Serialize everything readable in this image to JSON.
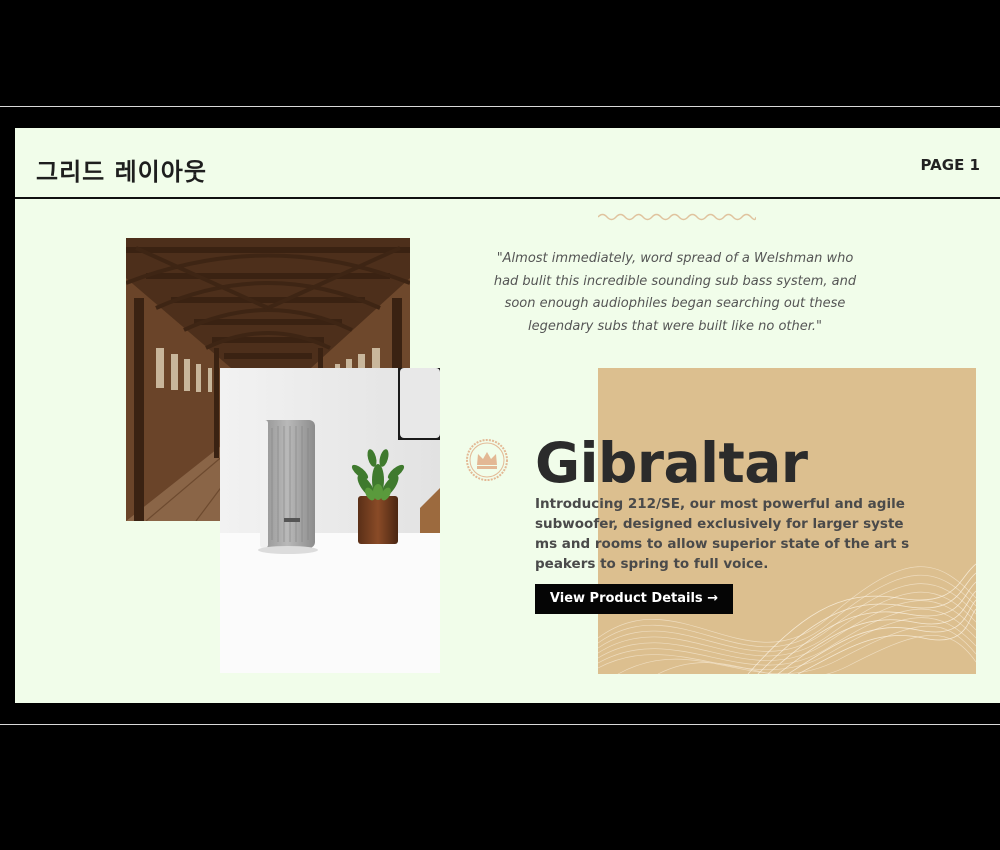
{
  "header": {
    "title": "그리드 레이아웃",
    "page_label": "PAGE 1"
  },
  "quote": {
    "text": "\"Almost immediately, word spread of a Welshman who had bulit this incredible sounding sub bass system, and soon enough audiophiles began searching out these legendary subs that were built like no other.\""
  },
  "product": {
    "name": "Gibraltar",
    "description": "Introducing 212/SE, our most powerful and agile subwoofer, designed exclusively for larger systems and rooms to allow superior state of the art speakers to spring to full voice.",
    "cta_label": "View Product Details →"
  },
  "icons": {
    "badge": "crown-icon",
    "divider": "wave-divider-icon"
  },
  "colors": {
    "slide_background": "#f1fdea",
    "accent_tan": "#dcbf8f",
    "badge_color": "#e3b894",
    "button_background": "#050505",
    "text_dark": "#2b2b2b"
  }
}
